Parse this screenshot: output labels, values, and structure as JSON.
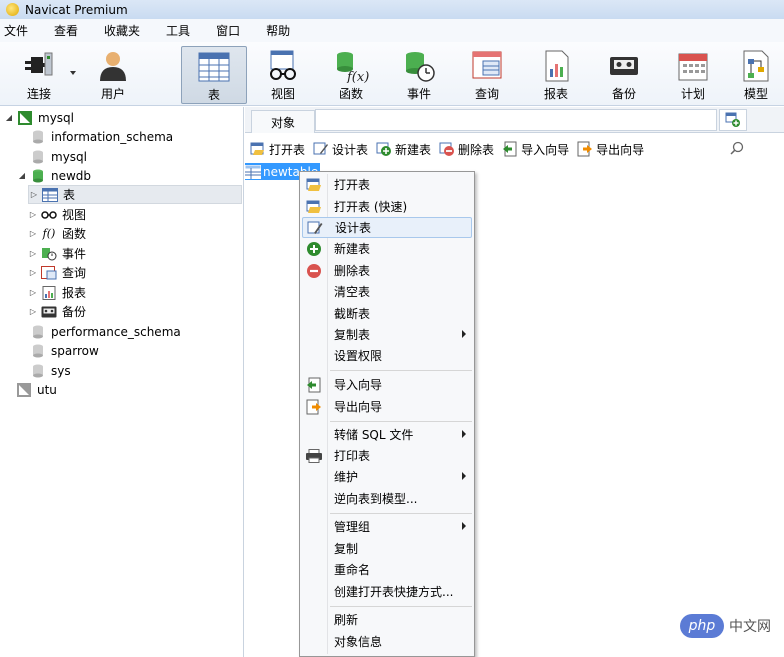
{
  "window": {
    "title": "Navicat Premium"
  },
  "menubar": [
    "文件",
    "查看",
    "收藏夹",
    "工具",
    "窗口",
    "帮助"
  ],
  "toolbar": {
    "buttons": [
      "连接",
      "用户",
      "表",
      "视图",
      "函数",
      "事件",
      "查询",
      "报表",
      "备份",
      "计划",
      "模型"
    ],
    "active": "表"
  },
  "tree": {
    "connections": [
      {
        "name": "mysql",
        "databases": [
          "information_schema",
          "mysql"
        ]
      },
      {
        "name": "newdb",
        "children": [
          "表",
          "视图",
          "函数",
          "事件",
          "查询",
          "报表",
          "备份"
        ]
      },
      {
        "name_list": [
          "performance_schema",
          "sparrow",
          "sys"
        ]
      },
      {
        "name": "utu"
      }
    ]
  },
  "right": {
    "tab": "对象",
    "actions": [
      "打开表",
      "设计表",
      "新建表",
      "删除表",
      "导入向导",
      "导出向导"
    ],
    "selected_item": "newtable"
  },
  "context_menu": [
    "打开表",
    "打开表 (快速)",
    "设计表",
    "新建表",
    "删除表",
    "清空表",
    "截断表",
    "复制表",
    "设置权限",
    "导入向导",
    "导出向导",
    "转储 SQL 文件",
    "打印表",
    "维护",
    "逆向表到模型...",
    "管理组",
    "复制",
    "重命名",
    "创建打开表快捷方式...",
    "刷新",
    "对象信息"
  ],
  "watermark": {
    "logo": "php",
    "text": "中文网"
  },
  "colors": {
    "selection": "#3399ff",
    "accent": "#2e8b2e"
  }
}
